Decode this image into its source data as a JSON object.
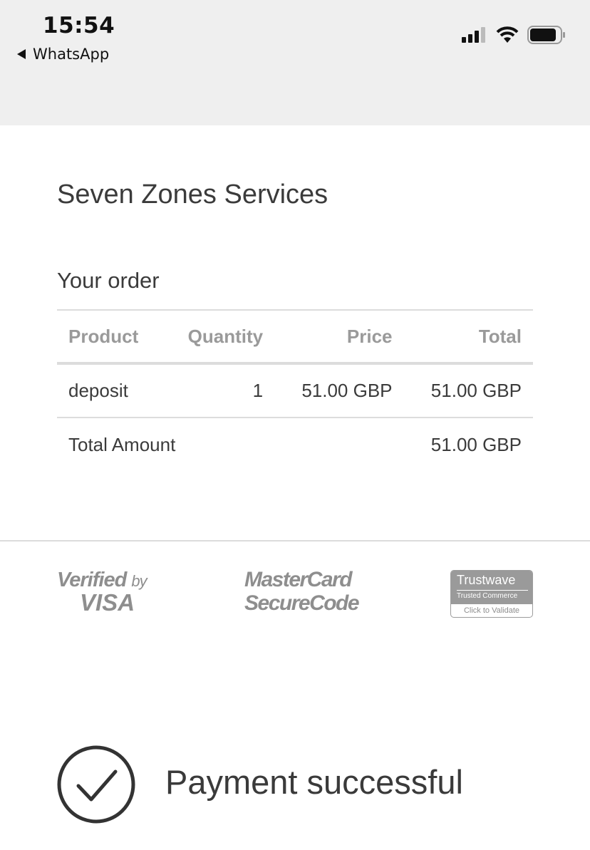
{
  "status_bar": {
    "time": "15:54",
    "back_app": "WhatsApp",
    "icons": [
      "back-triangle-icon",
      "signal-icon",
      "wifi-icon",
      "battery-icon"
    ]
  },
  "merchant": {
    "name": "Seven Zones Services"
  },
  "order": {
    "title": "Your order",
    "headers": {
      "product": "Product",
      "quantity": "Quantity",
      "price": "Price",
      "total": "Total"
    },
    "items": [
      {
        "product": "deposit",
        "quantity": "1",
        "price": "51.00 GBP",
        "total": "51.00 GBP"
      }
    ],
    "total_label": "Total Amount",
    "total_value": "51.00 GBP"
  },
  "security_logos": {
    "visa": {
      "line1": "Verified",
      "by": "by",
      "line2": "VISA"
    },
    "mastercard": {
      "line1": "MasterCard",
      "line2": "SecureCode"
    },
    "trustwave": {
      "name": "Trustwave",
      "sub": "Trusted Commerce",
      "action": "Click to Validate"
    }
  },
  "result": {
    "message": "Payment successful",
    "icon": "checkmark-circle-icon"
  },
  "colors": {
    "status_bar_bg": "#efefef",
    "text": "#3a3a3a",
    "muted": "#9a9a9a",
    "divider": "#dcdcdc"
  }
}
